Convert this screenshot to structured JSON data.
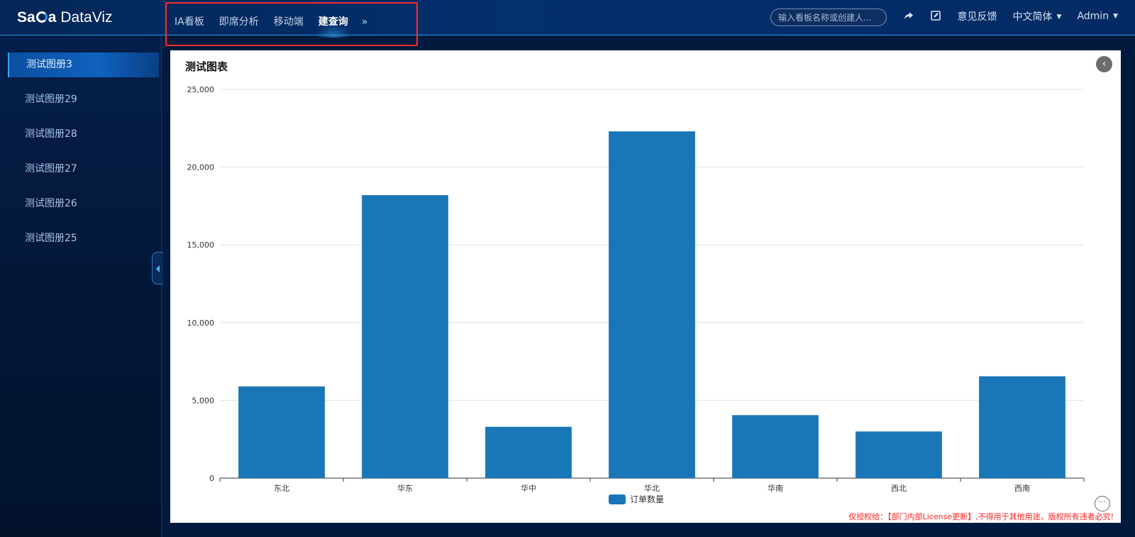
{
  "app": {
    "logo_mark_left": "Sa",
    "logo_mark_right": "a",
    "logo_text": "DataViz"
  },
  "topnav": {
    "items": [
      {
        "label": "IA看板",
        "active": false
      },
      {
        "label": "即席分析",
        "active": false
      },
      {
        "label": "移动端",
        "active": false
      },
      {
        "label": "建查询",
        "active": true
      }
    ],
    "more": "»"
  },
  "search": {
    "placeholder": "输入看板名称或创建人..."
  },
  "top_right": {
    "share_icon": "share-icon",
    "edit_icon": "edit-square-icon",
    "feedback": "意见反馈",
    "language": "中文简体",
    "user": "Admin"
  },
  "sidebar": {
    "items": [
      {
        "label": "测试图册3",
        "active": true
      },
      {
        "label": "测试图册29",
        "active": false
      },
      {
        "label": "测试图册28",
        "active": false
      },
      {
        "label": "测试图册27",
        "active": false
      },
      {
        "label": "测试图册26",
        "active": false
      },
      {
        "label": "测试图册25",
        "active": false
      }
    ]
  },
  "panel": {
    "title": "测试图表",
    "back_icon": "chevron-left-icon",
    "more_icon": "ellipsis-icon",
    "license": "仅授权给：【部门内部License更新】,不得用于其他用途，版权所有违者必究!"
  },
  "chart_data": {
    "type": "bar",
    "title": "测试图表",
    "categories": [
      "东北",
      "华东",
      "华中",
      "华北",
      "华南",
      "西北",
      "西南"
    ],
    "series": [
      {
        "name": "订单数量",
        "values": [
          5900,
          18200,
          3300,
          22300,
          4050,
          3000,
          6550
        ],
        "color": "#1a77b7"
      }
    ],
    "ylim": [
      0,
      25000
    ],
    "yticks": [
      0,
      5000,
      10000,
      15000,
      20000,
      25000
    ],
    "ytick_labels": [
      "0",
      "5,000",
      "10,000",
      "15,000",
      "20,000",
      "25,000"
    ],
    "grid": true,
    "legend_position": "bottom-center"
  }
}
